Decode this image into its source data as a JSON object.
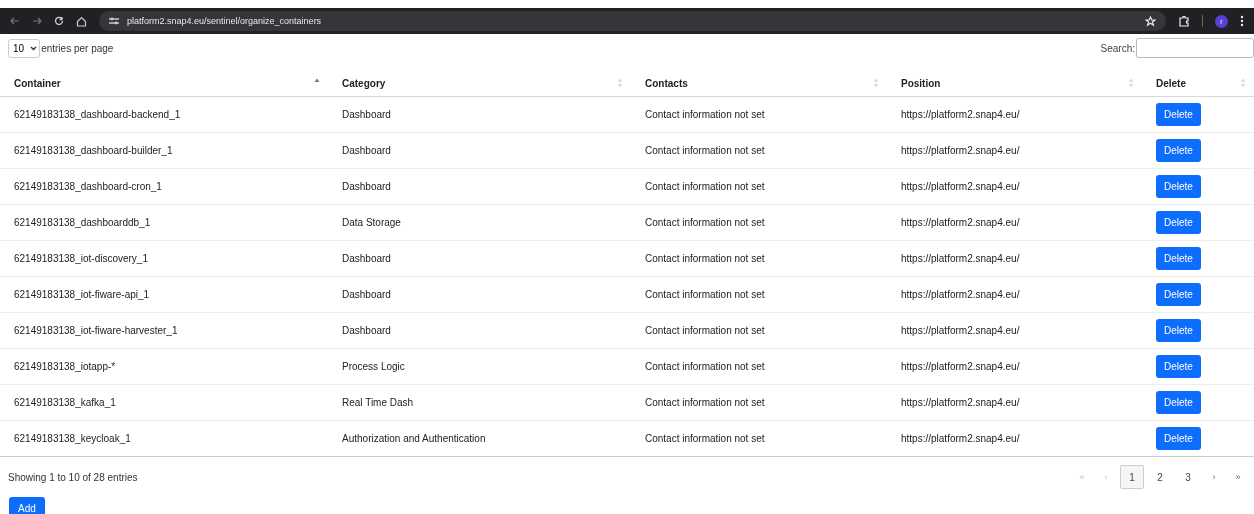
{
  "browser": {
    "url": "platform2.snap4.eu/sentinel/organize_containers",
    "profile_initial": "r"
  },
  "length_menu": {
    "value": "10",
    "label": "entries per page"
  },
  "search": {
    "label": "Search:"
  },
  "table": {
    "columns": [
      {
        "label": "Container",
        "sorted_ascending": true
      },
      {
        "label": "Category",
        "sorted_ascending": false
      },
      {
        "label": "Contacts",
        "sorted_ascending": false
      },
      {
        "label": "Position",
        "sorted_ascending": false
      },
      {
        "label": "Delete",
        "sorted_ascending": false
      }
    ],
    "rows": [
      {
        "container": "62149183138_dashboard-backend_1",
        "category": "Dashboard",
        "contacts": "Contact information not set",
        "position": "https://platform2.snap4.eu/",
        "action": "Delete"
      },
      {
        "container": "62149183138_dashboard-builder_1",
        "category": "Dashboard",
        "contacts": "Contact information not set",
        "position": "https://platform2.snap4.eu/",
        "action": "Delete"
      },
      {
        "container": "62149183138_dashboard-cron_1",
        "category": "Dashboard",
        "contacts": "Contact information not set",
        "position": "https://platform2.snap4.eu/",
        "action": "Delete"
      },
      {
        "container": "62149183138_dashboarddb_1",
        "category": "Data Storage",
        "contacts": "Contact information not set",
        "position": "https://platform2.snap4.eu/",
        "action": "Delete"
      },
      {
        "container": "62149183138_iot-discovery_1",
        "category": "Dashboard",
        "contacts": "Contact information not set",
        "position": "https://platform2.snap4.eu/",
        "action": "Delete"
      },
      {
        "container": "62149183138_iot-fiware-api_1",
        "category": "Dashboard",
        "contacts": "Contact information not set",
        "position": "https://platform2.snap4.eu/",
        "action": "Delete"
      },
      {
        "container": "62149183138_iot-fiware-harvester_1",
        "category": "Dashboard",
        "contacts": "Contact information not set",
        "position": "https://platform2.snap4.eu/",
        "action": "Delete"
      },
      {
        "container": "62149183138_iotapp-*",
        "category": "Process Logic",
        "contacts": "Contact information not set",
        "position": "https://platform2.snap4.eu/",
        "action": "Delete"
      },
      {
        "container": "62149183138_kafka_1",
        "category": "Real Time Dash",
        "contacts": "Contact information not set",
        "position": "https://platform2.snap4.eu/",
        "action": "Delete"
      },
      {
        "container": "62149183138_keycloak_1",
        "category": "Authorization and Authentication",
        "contacts": "Contact information not set",
        "position": "https://platform2.snap4.eu/",
        "action": "Delete"
      }
    ]
  },
  "info": "Showing 1 to 10 of 28 entries",
  "pagination": [
    {
      "label": "«",
      "kind": "nav",
      "disabled": true,
      "selected": false
    },
    {
      "label": "‹",
      "kind": "nav",
      "disabled": true,
      "selected": false
    },
    {
      "label": "1",
      "kind": "page",
      "disabled": false,
      "selected": true
    },
    {
      "label": "2",
      "kind": "page",
      "disabled": false,
      "selected": false
    },
    {
      "label": "3",
      "kind": "page",
      "disabled": false,
      "selected": false
    },
    {
      "label": "›",
      "kind": "nav",
      "disabled": false,
      "selected": false
    },
    {
      "label": "»",
      "kind": "nav",
      "disabled": false,
      "selected": false
    }
  ],
  "add_button": "Add"
}
